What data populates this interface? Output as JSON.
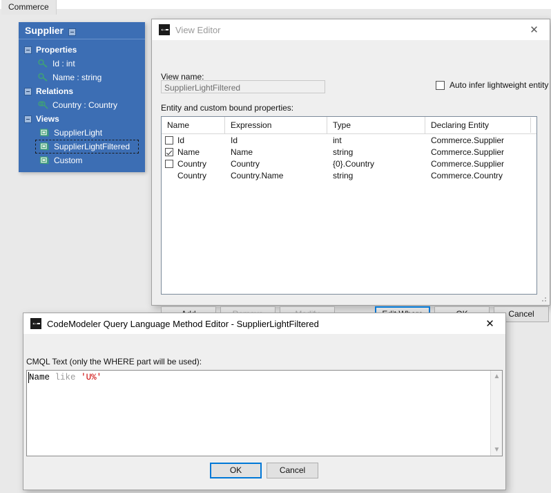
{
  "tab": {
    "label": "Commerce"
  },
  "entity_panel": {
    "title": "Supplier",
    "collapse_icon": "minus-box-icon",
    "groups": [
      {
        "label": "Properties",
        "items": [
          {
            "label": "Id : int",
            "icon": "key-property-icon"
          },
          {
            "label": "Name : string",
            "icon": "key-property-icon"
          }
        ]
      },
      {
        "label": "Relations",
        "items": [
          {
            "label": "Country : Country",
            "icon": "relation-key-icon"
          }
        ]
      },
      {
        "label": "Views",
        "items": [
          {
            "label": "SupplierLight",
            "icon": "view-icon",
            "selected": false
          },
          {
            "label": "SupplierLightFiltered",
            "icon": "view-icon",
            "selected": true
          },
          {
            "label": "Custom",
            "icon": "view-icon",
            "selected": false
          }
        ]
      }
    ]
  },
  "view_editor": {
    "title": "View Editor",
    "app_icon": "back-arrow-app-icon",
    "close_icon": "close-icon",
    "view_name_label": "View name:",
    "view_name_value": "SupplierLightFiltered",
    "auto_infer": {
      "label": "Auto infer lightweight entity",
      "checked": false
    },
    "grid_label": "Entity and custom bound properties:",
    "grid": {
      "columns": [
        "Name",
        "Expression",
        "Type",
        "Declaring Entity"
      ],
      "rows": [
        {
          "checkbox": "unchecked",
          "name": "Id",
          "expression": "Id",
          "type": "int",
          "declaring_entity": "Commerce.Supplier"
        },
        {
          "checkbox": "checked",
          "name": "Name",
          "expression": "Name",
          "type": "string",
          "declaring_entity": "Commerce.Supplier"
        },
        {
          "checkbox": "unchecked",
          "name": "Country",
          "expression": "Country",
          "type": "{0}.Country",
          "declaring_entity": "Commerce.Supplier"
        },
        {
          "checkbox": "none",
          "name": "Country",
          "expression": "Country.Name",
          "type": "string",
          "declaring_entity": "Commerce.Country"
        }
      ]
    },
    "buttons": {
      "add": "Add",
      "remove": "Remove",
      "modify": "Modify",
      "edit_where": "Edit Where",
      "ok": "OK",
      "cancel": "Cancel"
    }
  },
  "cmql_dialog": {
    "title": "CodeModeler Query Language Method Editor - SupplierLightFiltered",
    "app_icon": "back-arrow-app-icon",
    "close_icon": "close-icon",
    "text_label": "CMQL Text (only the WHERE part will be used):",
    "editor": {
      "tokens": [
        {
          "text": "Name",
          "kind": "identifier"
        },
        {
          "text": " ",
          "kind": "space"
        },
        {
          "text": "like",
          "kind": "keyword"
        },
        {
          "text": " ",
          "kind": "space"
        },
        {
          "text": "'U%'",
          "kind": "string"
        }
      ],
      "full_text": "Name like 'U%'"
    },
    "scrollbar": {
      "up_icon": "chevron-up-icon",
      "down_icon": "chevron-down-icon"
    },
    "buttons": {
      "ok": "OK",
      "cancel": "Cancel"
    }
  },
  "colors": {
    "panel_blue": "#3c6eb4",
    "accent_blue": "#0078d7",
    "string_red": "#cc0000",
    "keyword_gray": "#9a9a9a",
    "dialog_bg": "#efefef",
    "canvas_bg": "#e9e9e9"
  }
}
